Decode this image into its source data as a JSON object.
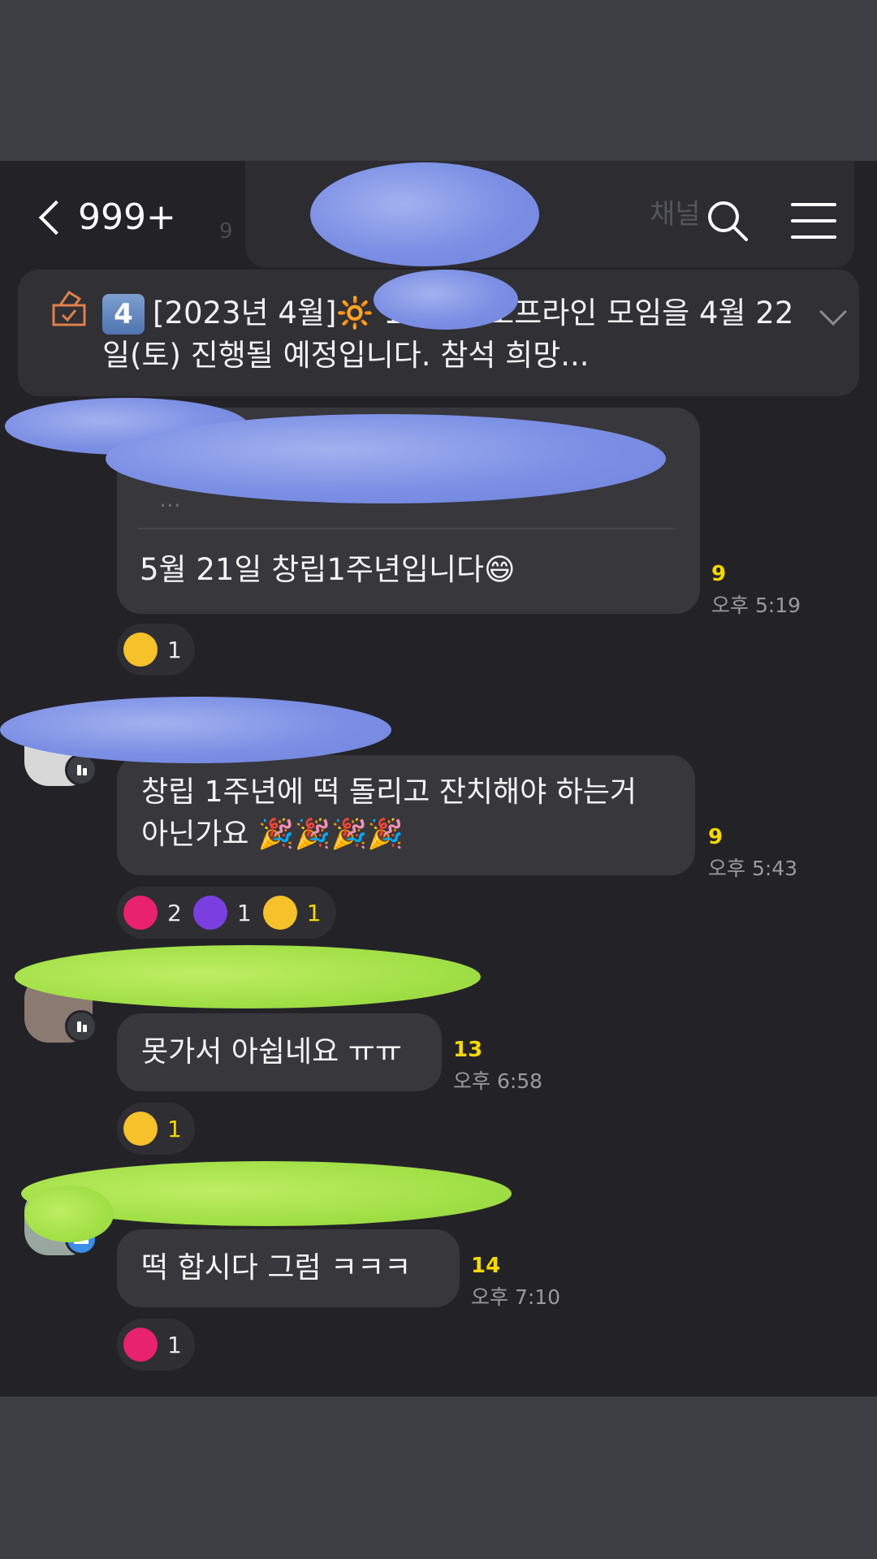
{
  "header": {
    "back_count": "999+",
    "bg_card_text": "채널",
    "bg_num": "9"
  },
  "notice": {
    "number_badge": "4",
    "text": "[2023년 4월]🔆 12회차 오프라인 모임을 4월 22일(토) 진행될 예정입니다. 참석 희망..."
  },
  "messages": [
    {
      "quote_faint": "...",
      "text": "5월 21일 창립1주년입니다😄",
      "unread": "9",
      "time": "오후 5:19",
      "reactions": [
        {
          "emoji": "grinning-squint-face",
          "count": "1"
        }
      ]
    },
    {
      "text_line1": "창립 1주년에 떡 돌리고 잔치해야 하는거",
      "text_line2": "아닌가요 🎉🎉🎉🎉",
      "unread": "9",
      "time": "오후 5:43",
      "reactions": [
        {
          "emoji": "heart",
          "count": "2"
        },
        {
          "emoji": "thumbs-up",
          "count": "1"
        },
        {
          "emoji": "grinning-squint-face",
          "count": "1"
        }
      ]
    },
    {
      "text": "못가서 아쉽네요 ㅠㅠ",
      "unread": "13",
      "time": "오후 6:58",
      "reactions": [
        {
          "emoji": "sad-face",
          "count": "1"
        }
      ]
    },
    {
      "text": "떡 합시다 그럼 ㅋㅋㅋ",
      "unread": "14",
      "time": "오후 7:10",
      "reactions": [
        {
          "emoji": "heart",
          "count": "1"
        }
      ]
    }
  ],
  "colors": {
    "background": "#232327",
    "bubble": "#37373c",
    "unread": "#f5d800",
    "heart": "#e8226c",
    "thumbs": "#7b3fe0",
    "redact_blue": "#7b8fe4",
    "redact_green": "#a2e047"
  }
}
